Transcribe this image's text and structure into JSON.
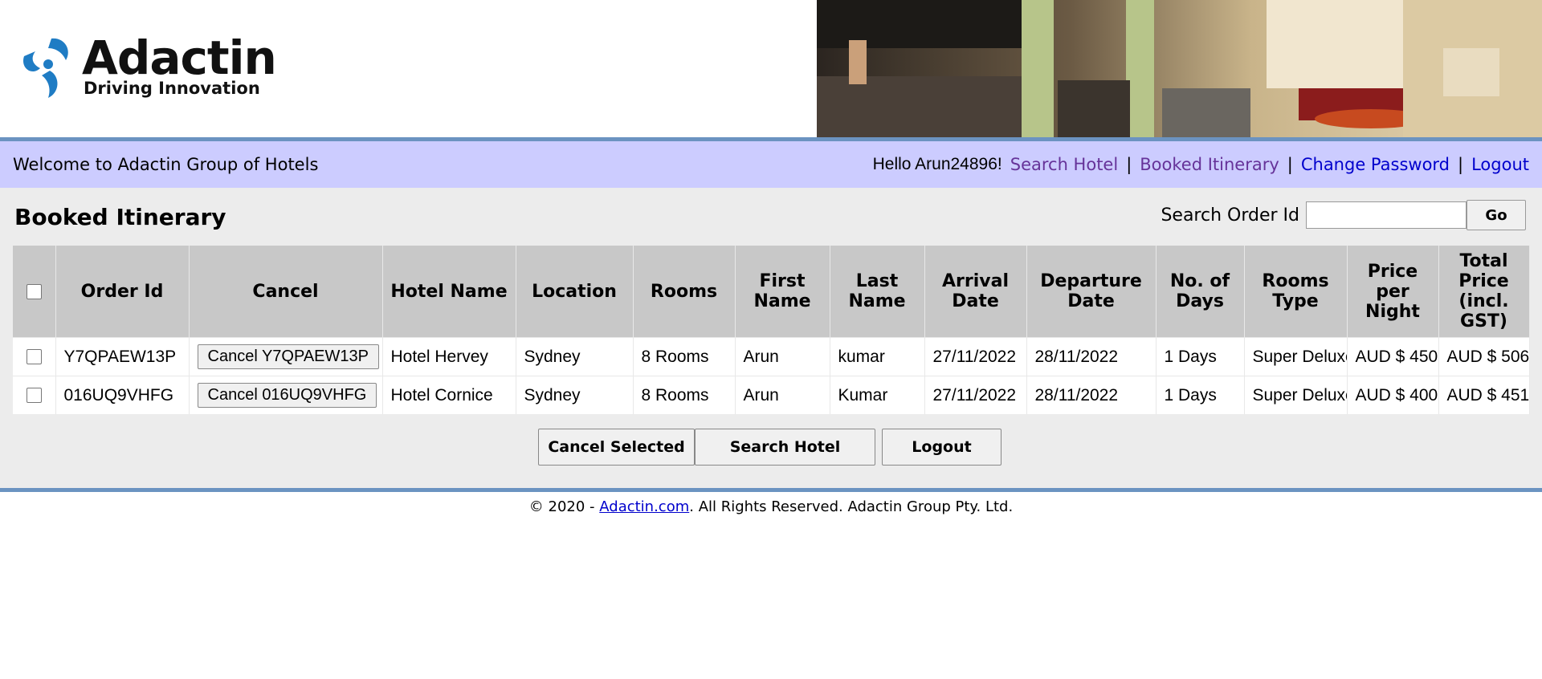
{
  "logo": {
    "name": "Adactin",
    "tagline": "Driving Innovation"
  },
  "nav": {
    "welcome": "Welcome to Adactin Group of Hotels",
    "hello": "Hello Arun24896!",
    "links": {
      "search_hotel": "Search Hotel",
      "booked_itinerary": "Booked Itinerary",
      "change_password": "Change Password",
      "logout": "Logout"
    },
    "separator": "|"
  },
  "page": {
    "title": "Booked Itinerary",
    "search_label": "Search Order Id",
    "search_value": "",
    "go_label": "Go"
  },
  "table": {
    "headers": [
      "Order Id",
      "Cancel",
      "Hotel Name",
      "Location",
      "Rooms",
      "First Name",
      "Last Name",
      "Arrival Date",
      "Departure Date",
      "No. of Days",
      "Rooms Type",
      "Price per Night",
      "Total Price (incl. GST)"
    ],
    "rows": [
      {
        "order_id": "Y7QPAEW13P",
        "cancel_label": "Cancel Y7QPAEW13P",
        "hotel_name": "Hotel Hervey",
        "location": "Sydney",
        "rooms": "8 Rooms",
        "first_name": "Arun",
        "last_name": "kumar",
        "arrival": "27/11/2022",
        "departure": "28/11/2022",
        "days": "1 Days",
        "rooms_type": "Super Deluxe",
        "price_night": "AUD $ 450",
        "total_price": "AUD $ 506"
      },
      {
        "order_id": "016UQ9VHFG",
        "cancel_label": "Cancel 016UQ9VHFG",
        "hotel_name": "Hotel Cornice",
        "location": "Sydney",
        "rooms": "8 Rooms",
        "first_name": "Arun",
        "last_name": "Kumar",
        "arrival": "27/11/2022",
        "departure": "28/11/2022",
        "days": "1 Days",
        "rooms_type": "Super Deluxe",
        "price_night": "AUD $ 400",
        "total_price": "AUD $ 451"
      }
    ]
  },
  "actions": {
    "cancel_selected": "Cancel Selected",
    "search_hotel": "Search Hotel",
    "logout": "Logout"
  },
  "footer": {
    "prefix": "© 2020 - ",
    "link": "Adactin.com",
    "suffix": ". All Rights Reserved. Adactin Group Pty. Ltd."
  },
  "colors": {
    "nav_bg": "#ccccff",
    "main_bg": "#ececec",
    "header_cell": "#c8c8c8",
    "rule": "#6b93c1",
    "link": "#0000cc",
    "visited": "#663399"
  }
}
